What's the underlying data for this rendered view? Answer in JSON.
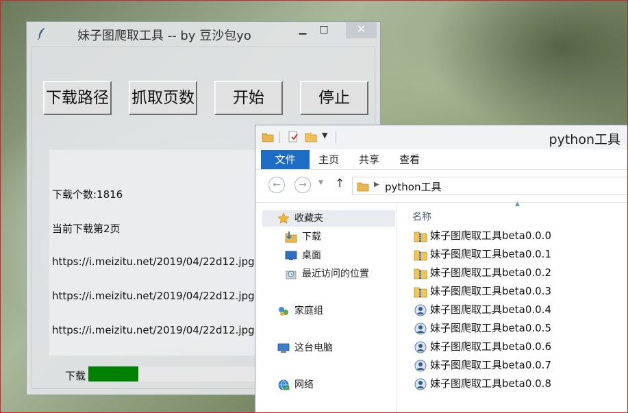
{
  "tk_window": {
    "title": "妹子图爬取工具 -- by 豆沙包yo",
    "controls": {
      "minimize": "▁",
      "maximize": "□",
      "close": "✕"
    },
    "buttons": {
      "download_path": "下载路径",
      "fetch_pages": "抓取页数",
      "start": "开始",
      "stop": "停止"
    },
    "log": {
      "download_count": "下载个数:1816",
      "current_page": "当前下载第2页",
      "urls": [
        "https://i.meizitu.net/2019/04/22d12.jpg",
        "https://i.meizitu.net/2019/04/22d12.jpg",
        "https://i.meizitu.net/2019/04/22d12.jpg"
      ]
    },
    "progress": {
      "label": "下载",
      "fraction": 0.29,
      "color": "#008000"
    }
  },
  "explorer": {
    "title": "python工具",
    "tabs": {
      "file": "文件",
      "home": "主页",
      "share": "共享",
      "view": "查看"
    },
    "accent_color": "#1d6dc6",
    "address": {
      "path": "python工具"
    },
    "nav": {
      "favorites": "收藏夹",
      "downloads": "下载",
      "desktop": "桌面",
      "recent": "最近访问的位置",
      "homegroup": "家庭组",
      "this_pc": "这台电脑",
      "network": "网络"
    },
    "column_header": "名称",
    "files": [
      {
        "name": "妹子图爬取工具beta0.0.0",
        "icon": "folder-zip-icon"
      },
      {
        "name": "妹子图爬取工具beta0.0.1",
        "icon": "folder-zip-icon"
      },
      {
        "name": "妹子图爬取工具beta0.0.2",
        "icon": "folder-zip-icon"
      },
      {
        "name": "妹子图爬取工具beta0.0.3",
        "icon": "folder-zip-icon"
      },
      {
        "name": "妹子图爬取工具beta0.0.4",
        "icon": "app-icon"
      },
      {
        "name": "妹子图爬取工具beta0.0.5",
        "icon": "app-icon"
      },
      {
        "name": "妹子图爬取工具beta0.0.6",
        "icon": "app-icon"
      },
      {
        "name": "妹子图爬取工具beta0.0.7",
        "icon": "app-icon"
      },
      {
        "name": "妹子图爬取工具beta0.0.8",
        "icon": "app-icon"
      }
    ]
  }
}
